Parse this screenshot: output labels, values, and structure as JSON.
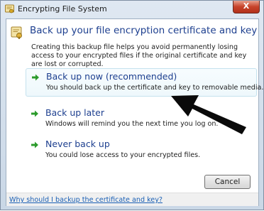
{
  "window": {
    "title": "Encrypting File System",
    "close_glyph": "X"
  },
  "header": {
    "title": "Back up your file encryption certificate and key",
    "icon": "certificate-key-icon"
  },
  "description": "Creating this backup file helps you avoid permanently losing access to your encrypted files if the original certificate and key are lost or corrupted.",
  "options": [
    {
      "title": "Back up now (recommended)",
      "desc": "You should back up the certificate and key to removable media.",
      "icon": "green-arrow-icon",
      "highlighted": true
    },
    {
      "title": "Back up later",
      "desc": "Windows will remind you the next time you log on.",
      "icon": "green-arrow-icon",
      "highlighted": false
    },
    {
      "title": "Never back up",
      "desc": "You could lose access to your encrypted files.",
      "icon": "green-arrow-icon",
      "highlighted": false
    }
  ],
  "buttons": {
    "cancel": "Cancel"
  },
  "footer": {
    "help_link": "Why should I backup the certificate and key?"
  },
  "colors": {
    "title_blue": "#1d3f8f",
    "link_blue": "#1a5fb4",
    "arrow_green": "#2c9b2c",
    "close_red": "#c7432a",
    "highlight_border": "#c5e2ee"
  }
}
